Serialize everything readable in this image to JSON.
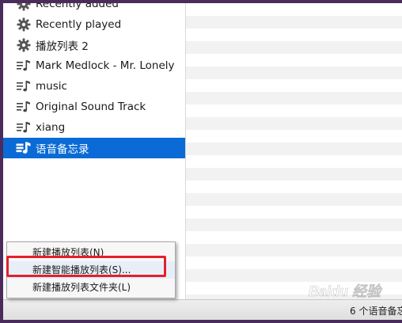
{
  "sidebar": {
    "items": [
      {
        "label": "Recently added",
        "icon": "gear-icon"
      },
      {
        "label": "Recently played",
        "icon": "gear-icon"
      },
      {
        "label": "播放列表 2",
        "icon": "gear-icon"
      },
      {
        "label": "Mark Medlock - Mr. Lonely",
        "icon": "playlist-icon"
      },
      {
        "label": "music",
        "icon": "playlist-icon"
      },
      {
        "label": "Original Sound Track",
        "icon": "playlist-icon"
      },
      {
        "label": "xiang",
        "icon": "playlist-icon"
      },
      {
        "label": "语音备忘录",
        "icon": "playlist-icon",
        "selected": true
      }
    ]
  },
  "context_menu": {
    "items": [
      {
        "label": "新建播放列表(N)"
      },
      {
        "label": "新建智能播放列表(S)...",
        "highlighted": true
      },
      {
        "label": "新建播放列表文件夹(L)"
      }
    ]
  },
  "statusbar": {
    "text": "6 个语音备忘"
  },
  "watermark": {
    "text": "Baidu 经验"
  },
  "colors": {
    "selection": "#0b6bd6",
    "highlight_box": "#e3202a",
    "background_frame": "#4a2c5c"
  }
}
